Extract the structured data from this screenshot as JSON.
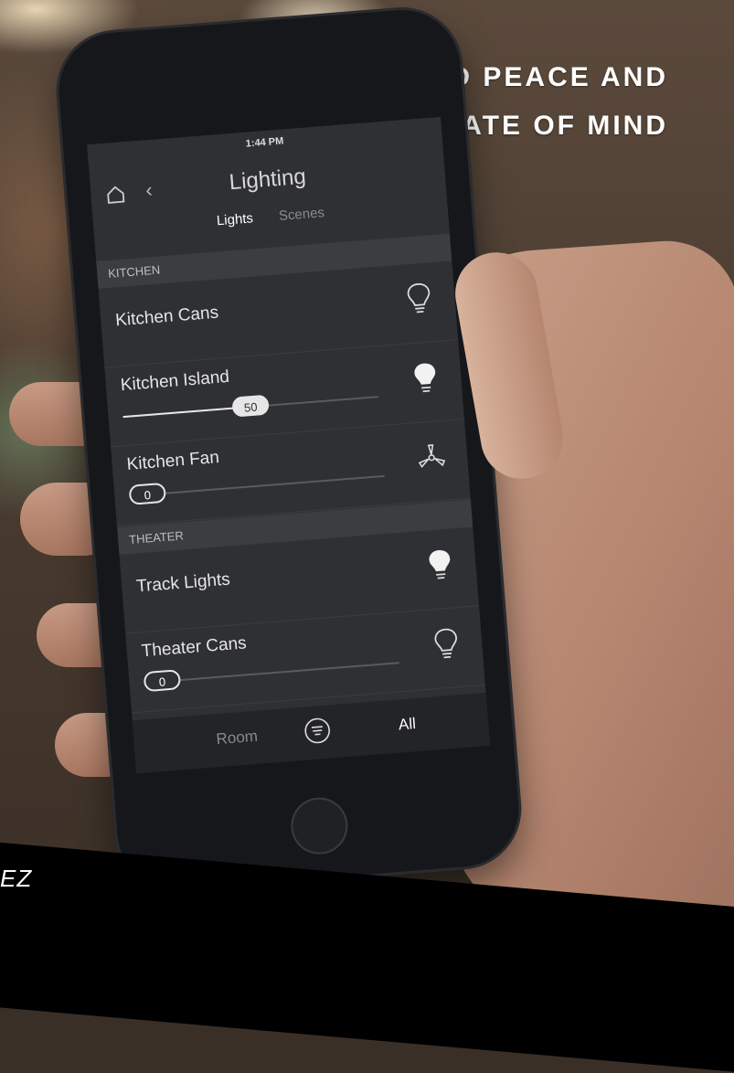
{
  "headline": {
    "line1": "GUARANTEED PEACE AND",
    "line2": "CE FOR THE FINEST STATE OF MIND"
  },
  "phone": {
    "status_time": "1:44 PM",
    "title": "Lighting",
    "tabs": [
      {
        "label": "Lights",
        "active": true
      },
      {
        "label": "Scenes",
        "active": false
      }
    ],
    "sections": [
      {
        "label": "KITCHEN"
      },
      {
        "label": "THEATER"
      }
    ],
    "rows": [
      {
        "name": "Kitchen Cans",
        "icon": "bulb-off-icon"
      },
      {
        "name": "Kitchen Island",
        "icon": "bulb-on-icon",
        "level": 50,
        "level_label": "50"
      },
      {
        "name": "Kitchen Fan",
        "icon": "fan-icon",
        "level": 0,
        "level_label": "0"
      },
      {
        "name": "Track Lights",
        "icon": "bulb-on-icon"
      },
      {
        "name": "Theater Cans",
        "icon": "bulb-off-icon",
        "level": 0,
        "level_label": "0"
      }
    ],
    "bottom": {
      "room": "Room",
      "all": "All"
    }
  },
  "banner": {
    "text": "EZ"
  },
  "colors": {
    "screen": "#2f3033",
    "text": "#e6e6e6",
    "accent": "#ffffff"
  }
}
